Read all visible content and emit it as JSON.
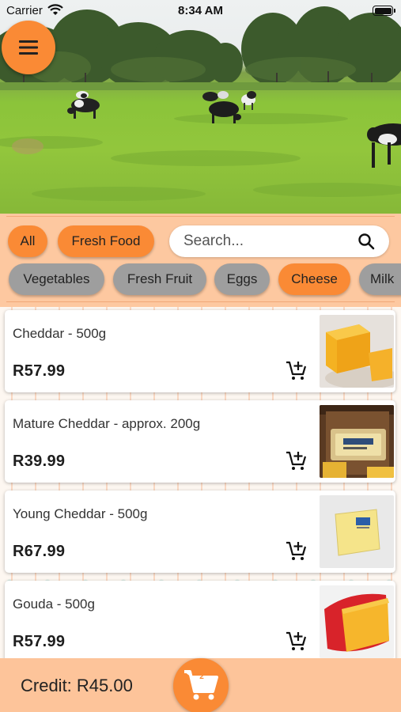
{
  "status_bar": {
    "carrier": "Carrier",
    "time": "8:34 AM"
  },
  "hero": {
    "image": "pasture-with-grazing-cows"
  },
  "menu_button": {
    "icon": "hamburger-menu-icon"
  },
  "filters": {
    "row1": [
      {
        "label": "All",
        "color": "#fa8a35"
      },
      {
        "label": "Fresh Food",
        "color": "#fa8a35"
      }
    ],
    "row2": [
      {
        "label": "Vegetables",
        "color": "#9e9e9e"
      },
      {
        "label": "Fresh Fruit",
        "color": "#9e9e9e"
      },
      {
        "label": "Eggs",
        "color": "#9e9e9e"
      },
      {
        "label": "Cheese",
        "color": "#fa8a35",
        "selected": true
      },
      {
        "label": "Milk",
        "color": "#9e9e9e"
      }
    ]
  },
  "search": {
    "placeholder": "Search...",
    "icon": "search-icon"
  },
  "products": [
    {
      "name": "Cheddar - 500g",
      "price": "R57.99",
      "image": "cheddar-block"
    },
    {
      "name": "Mature Cheddar - approx. 200g",
      "price": "R39.99",
      "image": "mature-cheddar-pack"
    },
    {
      "name": "Young Cheddar - 500g",
      "price": "R67.99",
      "image": "young-cheddar-wrapped"
    },
    {
      "name": "Gouda - 500g",
      "price": "R57.99",
      "image": "gouda-wheel-wedge"
    }
  ],
  "footer": {
    "credit": "Credit: R45.00",
    "cart_count": "2",
    "cart_icon": "shopping-cart-icon"
  },
  "colors": {
    "accent": "#fa8a35",
    "panel": "#fdc8a0",
    "chip_inactive": "#9e9e9e"
  }
}
